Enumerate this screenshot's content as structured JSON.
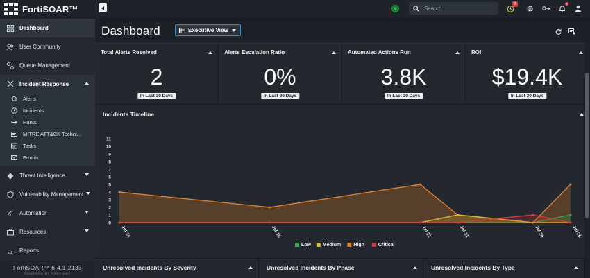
{
  "app": {
    "brand": "FortiSOAR™",
    "version": "FortiSOAR™  6.4.1-2133",
    "powered_by": "POWERED BY FORTINET"
  },
  "sidebar": {
    "items": [
      {
        "label": "Dashboard",
        "icon": "dashboard-icon",
        "active": true
      },
      {
        "label": "User Community",
        "icon": "users-icon"
      },
      {
        "label": "Queue Management",
        "icon": "queue-icon"
      },
      {
        "label": "Incident Response",
        "icon": "incident-response-icon",
        "expanded": true,
        "children": [
          {
            "label": "Alerts",
            "icon": "alert-icon"
          },
          {
            "label": "Incidents",
            "icon": "incident-icon"
          },
          {
            "label": "Hunts",
            "icon": "hunt-icon"
          },
          {
            "label": "MITRE ATT&CK Techni...",
            "icon": "mitre-icon"
          },
          {
            "label": "Tasks",
            "icon": "tasks-icon"
          },
          {
            "label": "Emails",
            "icon": "email-icon"
          }
        ]
      },
      {
        "label": "Threat Intelligence",
        "icon": "threat-intel-icon"
      },
      {
        "label": "Vulnerability Management",
        "icon": "vulnerability-icon"
      },
      {
        "label": "Automation",
        "icon": "automation-icon"
      },
      {
        "label": "Resources",
        "icon": "resources-icon"
      },
      {
        "label": "Reports",
        "icon": "reports-icon"
      }
    ]
  },
  "topbar": {
    "search_placeholder": "Search",
    "timer_badge": "3",
    "bell_badge": "4"
  },
  "dashboard": {
    "title": "Dashboard",
    "view": "Executive View",
    "cards": [
      {
        "title": "Total Alerts Resolved",
        "value": "2",
        "sub": "In Last 30 Days"
      },
      {
        "title": "Alerts Escalation Ratio",
        "value": "0%",
        "sub": "In Last 30 Days"
      },
      {
        "title": "Automated Actions Run",
        "value": "3.8K",
        "sub": "In Last 30 Days"
      },
      {
        "title": "ROI",
        "value": "$19.4K",
        "sub": "In Last 30 Days"
      }
    ],
    "timeline_title": "Incidents Timeline",
    "bottom_panels": [
      {
        "title": "Unresolved Incidents By Severity"
      },
      {
        "title": "Unresolved Incidents By Phase"
      },
      {
        "title": "Unresolved Incidents By Type"
      }
    ]
  },
  "colors": {
    "low": "#2fa84f",
    "medium": "#d7b82b",
    "high": "#e07f24",
    "critical": "#d6383d",
    "accent": "#3b8ec0"
  },
  "chart_data": {
    "type": "area",
    "title": "Incidents Timeline",
    "x": [
      "Jul 14",
      "Jul 18",
      "Jul 22",
      "Jul 23",
      "Jul 25",
      "Jul 26"
    ],
    "x_days": [
      14,
      18,
      22,
      23,
      25,
      26
    ],
    "y_ticks": [
      0,
      1,
      2,
      3,
      4,
      5,
      6,
      7,
      8,
      9,
      10,
      11
    ],
    "ylim": [
      0,
      11
    ],
    "legend_position": "bottom",
    "series": [
      {
        "name": "Low",
        "color": "#2fa84f",
        "values": [
          0,
          0,
          0,
          0,
          0,
          1
        ]
      },
      {
        "name": "Medium",
        "color": "#d7b82b",
        "values": [
          0,
          0,
          0,
          1,
          0,
          0
        ]
      },
      {
        "name": "High",
        "color": "#e07f24",
        "values": [
          4,
          2,
          5,
          1,
          0,
          5
        ]
      },
      {
        "name": "Critical",
        "color": "#d6383d",
        "values": [
          0,
          0,
          0,
          0,
          1,
          0
        ]
      }
    ]
  }
}
